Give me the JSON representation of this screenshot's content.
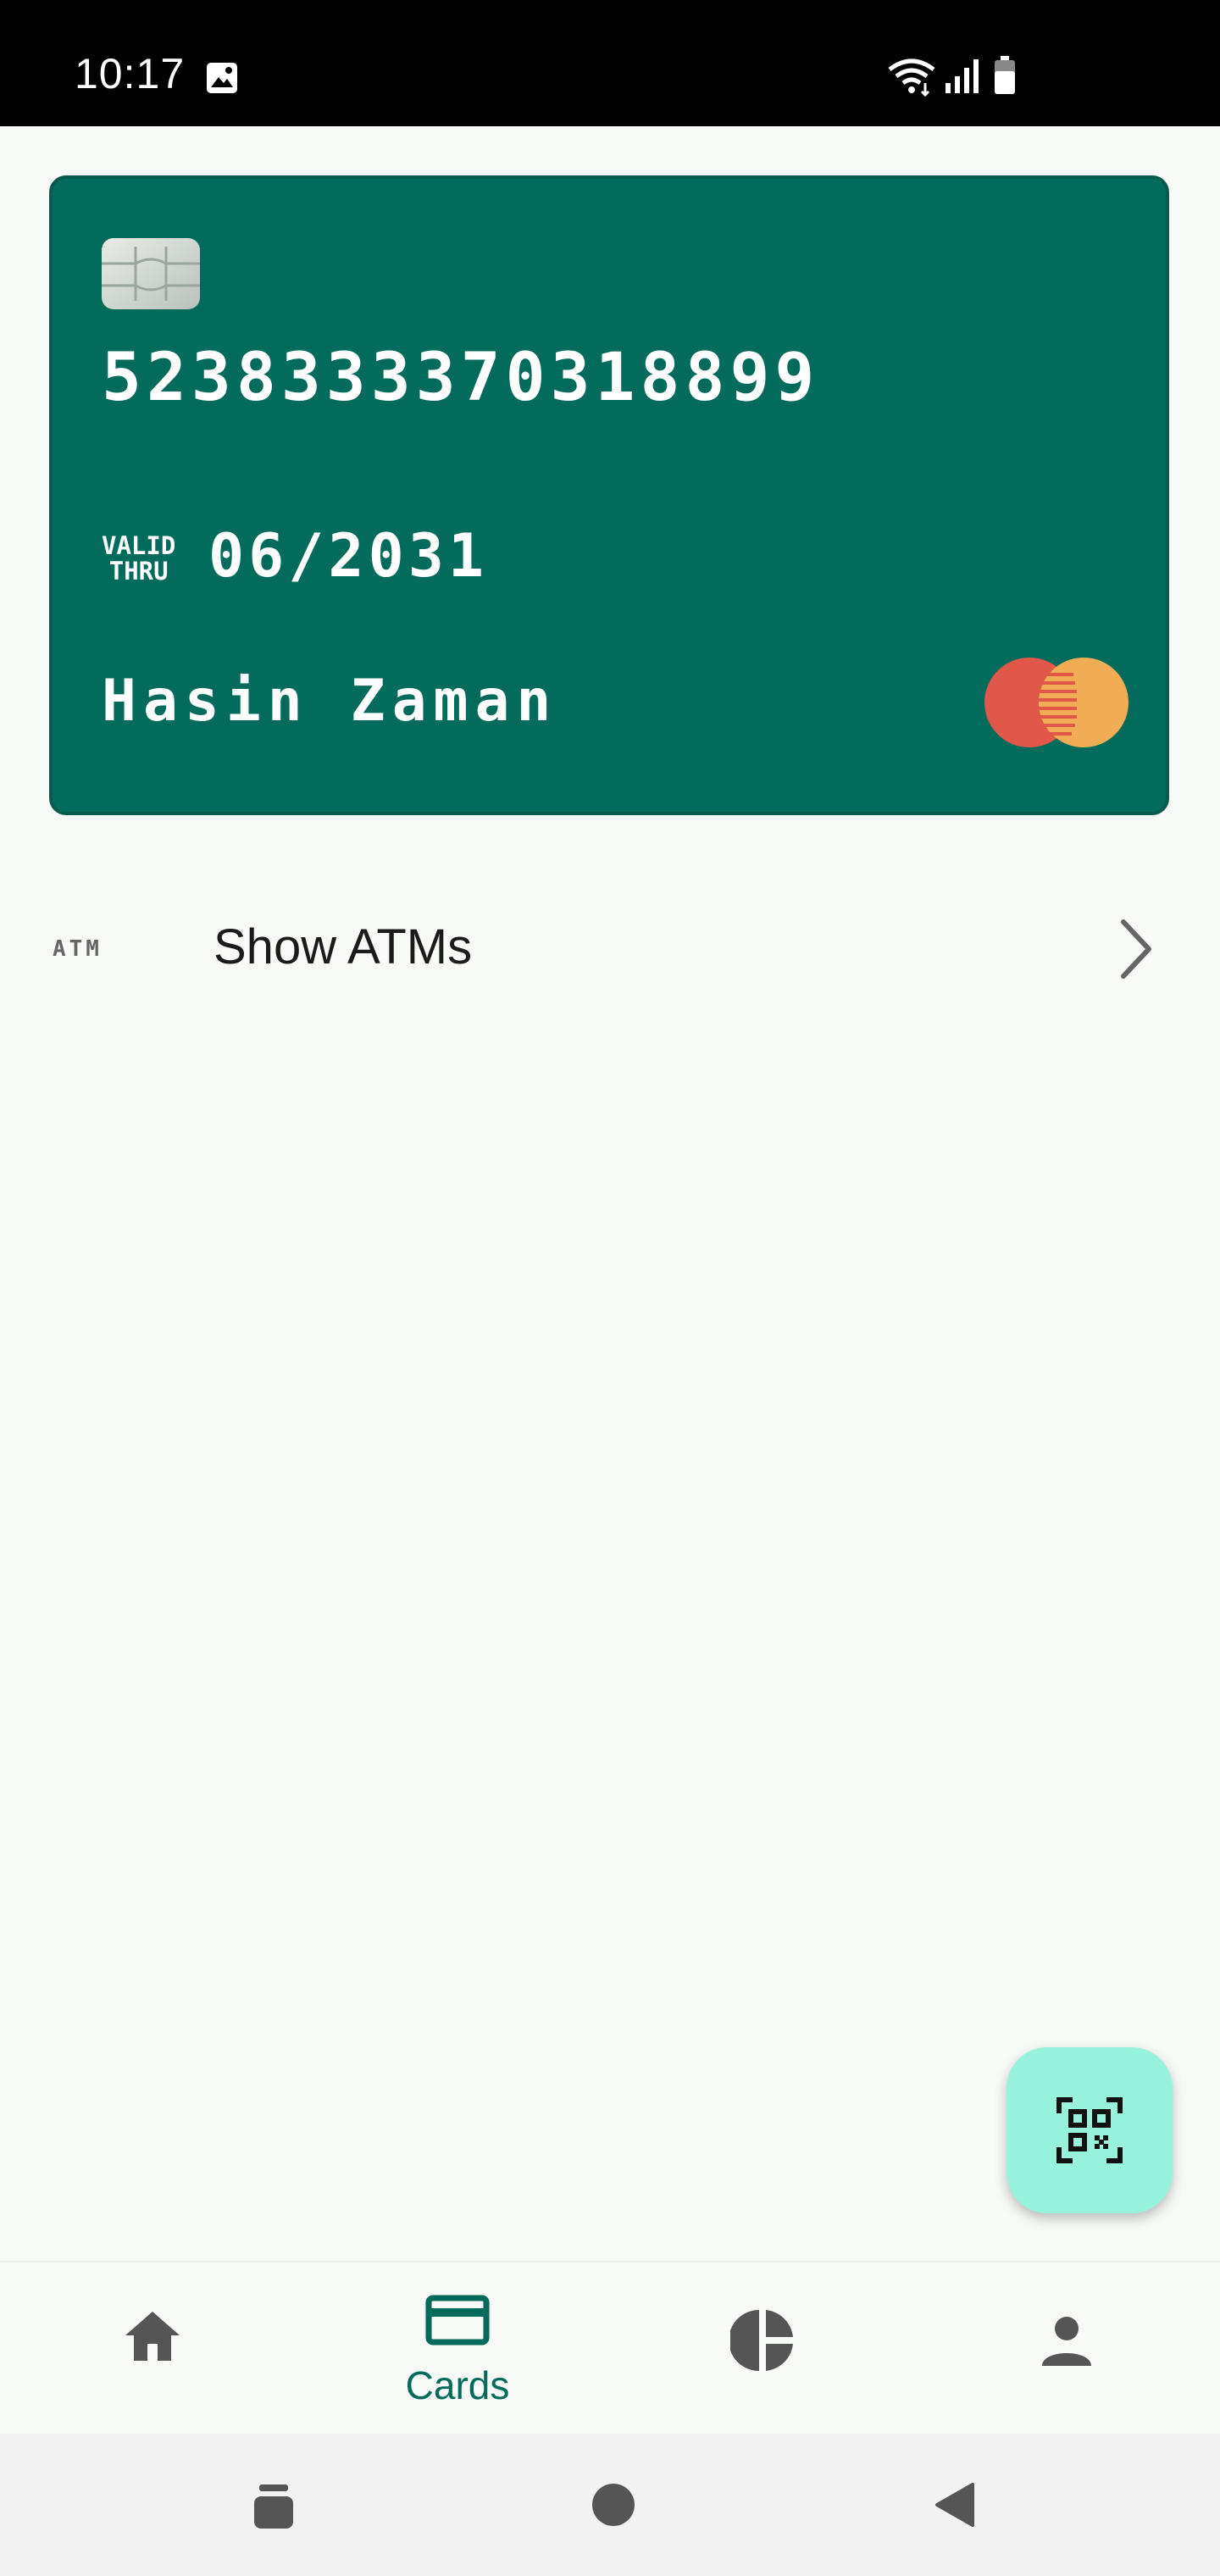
{
  "status_bar": {
    "time": "10:17",
    "icons": [
      "gallery-icon",
      "wifi-icon",
      "signal-icon",
      "battery-icon"
    ]
  },
  "card": {
    "number": "5238333370318899",
    "valid_thru_line1": "VALID",
    "valid_thru_line2": "THRU",
    "expiry": "06/2031",
    "holder": "Hasin Zaman",
    "network_icon": "mastercard-logo",
    "color": "#026b5c"
  },
  "atm_row": {
    "icon_text": "ATM",
    "label": "Show ATMs"
  },
  "fab": {
    "icon": "qr-scan-icon",
    "color": "#98f3dc"
  },
  "bottom_nav": {
    "items": [
      {
        "icon": "home-icon",
        "label": ""
      },
      {
        "icon": "card-icon",
        "label": "Cards",
        "active": true
      },
      {
        "icon": "pie-chart-icon",
        "label": ""
      },
      {
        "icon": "person-icon",
        "label": ""
      }
    ]
  },
  "system_nav": [
    "recents-icon",
    "home-circle-icon",
    "back-icon"
  ]
}
